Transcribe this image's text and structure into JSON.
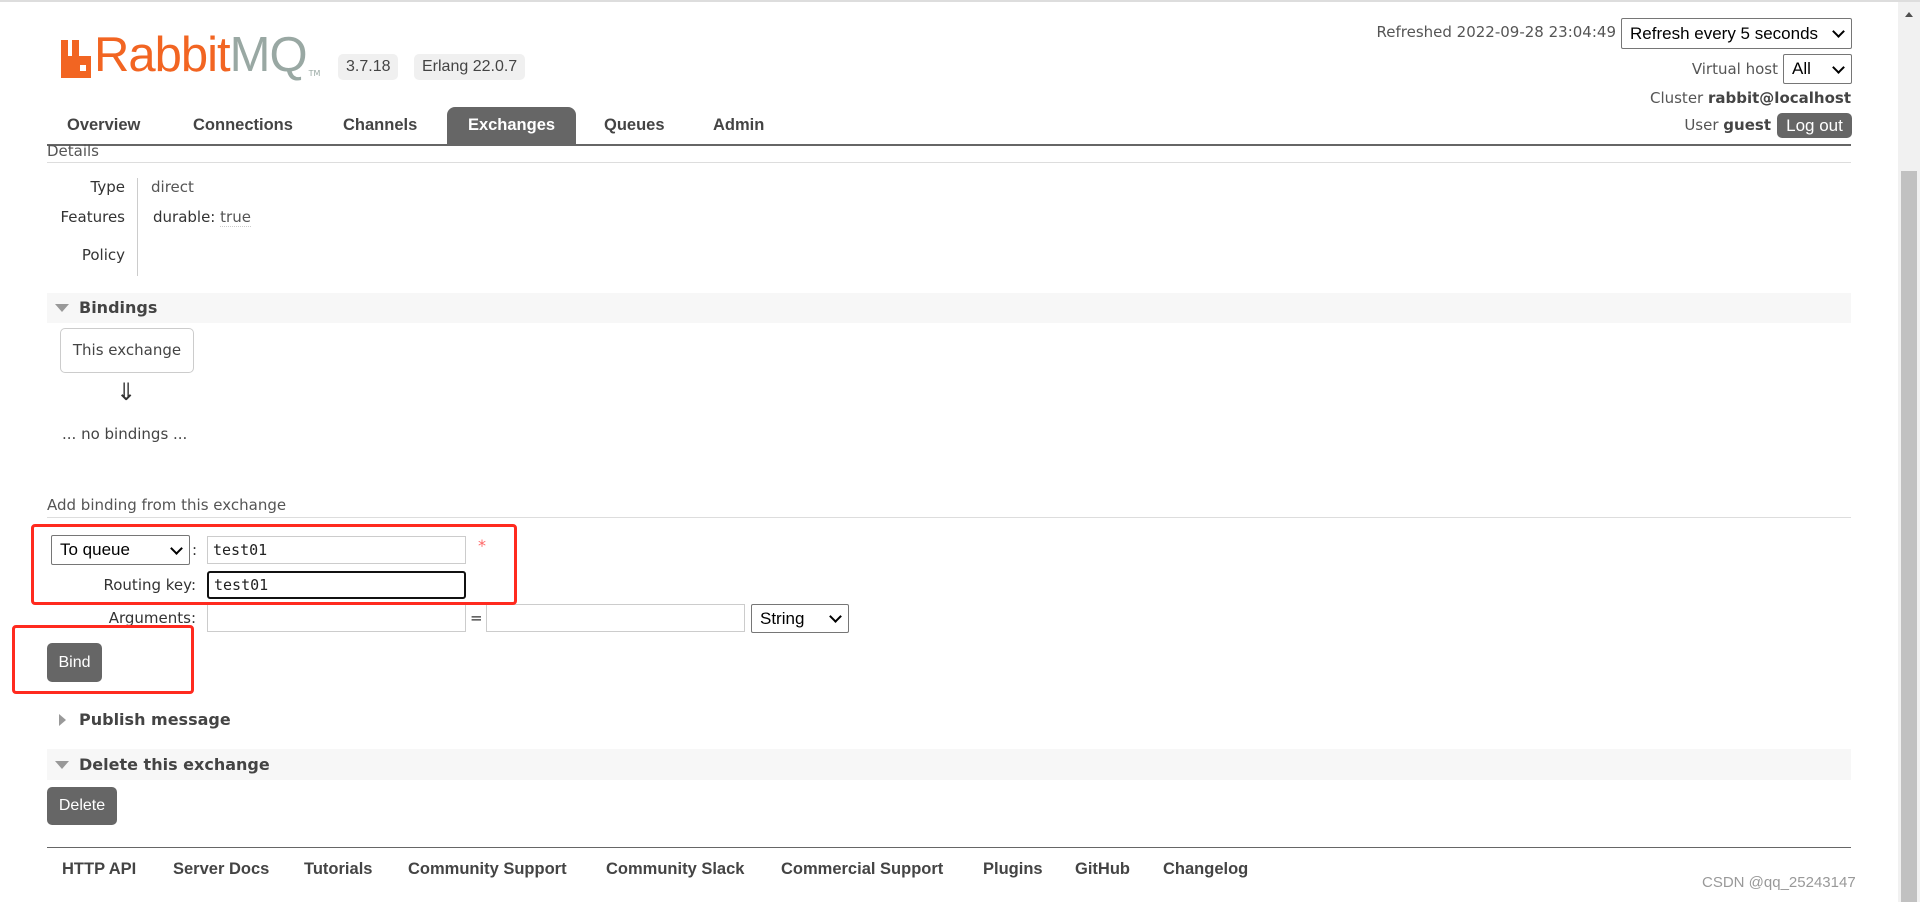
{
  "header": {
    "logo_text": "RabbitMQ",
    "logo_brand_color": "#f26522",
    "version": "3.7.18",
    "erlang": "Erlang 22.0.7",
    "refreshed": "Refreshed 2022-09-28 23:04:49",
    "refresh_select": "Refresh every 5 seconds",
    "vhost_label": "Virtual host",
    "vhost_select": "All",
    "cluster_label": "Cluster",
    "cluster_value": "rabbit@localhost",
    "user_label": "User",
    "user_value": "guest",
    "logout": "Log out"
  },
  "tabs": [
    "Overview",
    "Connections",
    "Channels",
    "Exchanges",
    "Queues",
    "Admin"
  ],
  "active_tab": "Exchanges",
  "details": {
    "title": "Details",
    "rows": [
      {
        "label": "Type",
        "value": "direct"
      },
      {
        "label": "Features",
        "key": "durable:",
        "value": "true"
      },
      {
        "label": "Policy",
        "value": ""
      }
    ]
  },
  "bindings": {
    "title": "Bindings",
    "this_exchange": "This exchange",
    "arrow": "⇓",
    "empty": "... no bindings ..."
  },
  "add_binding": {
    "title": "Add binding from this exchange",
    "destination_type": "To queue",
    "destination_value": "test01",
    "required_mark": "*",
    "routing_key_label": "Routing key:",
    "routing_key_value": "test01",
    "arguments_label": "Arguments:",
    "arg_key": "",
    "arg_value": "",
    "equals": "=",
    "arg_type": "String",
    "bind_button": "Bind"
  },
  "publish": {
    "title": "Publish message"
  },
  "delete": {
    "title": "Delete this exchange",
    "button": "Delete"
  },
  "footer": [
    "HTTP API",
    "Server Docs",
    "Tutorials",
    "Community Support",
    "Community Slack",
    "Commercial Support",
    "Plugins",
    "GitHub",
    "Changelog"
  ],
  "watermark": "CSDN @qq_25243147"
}
